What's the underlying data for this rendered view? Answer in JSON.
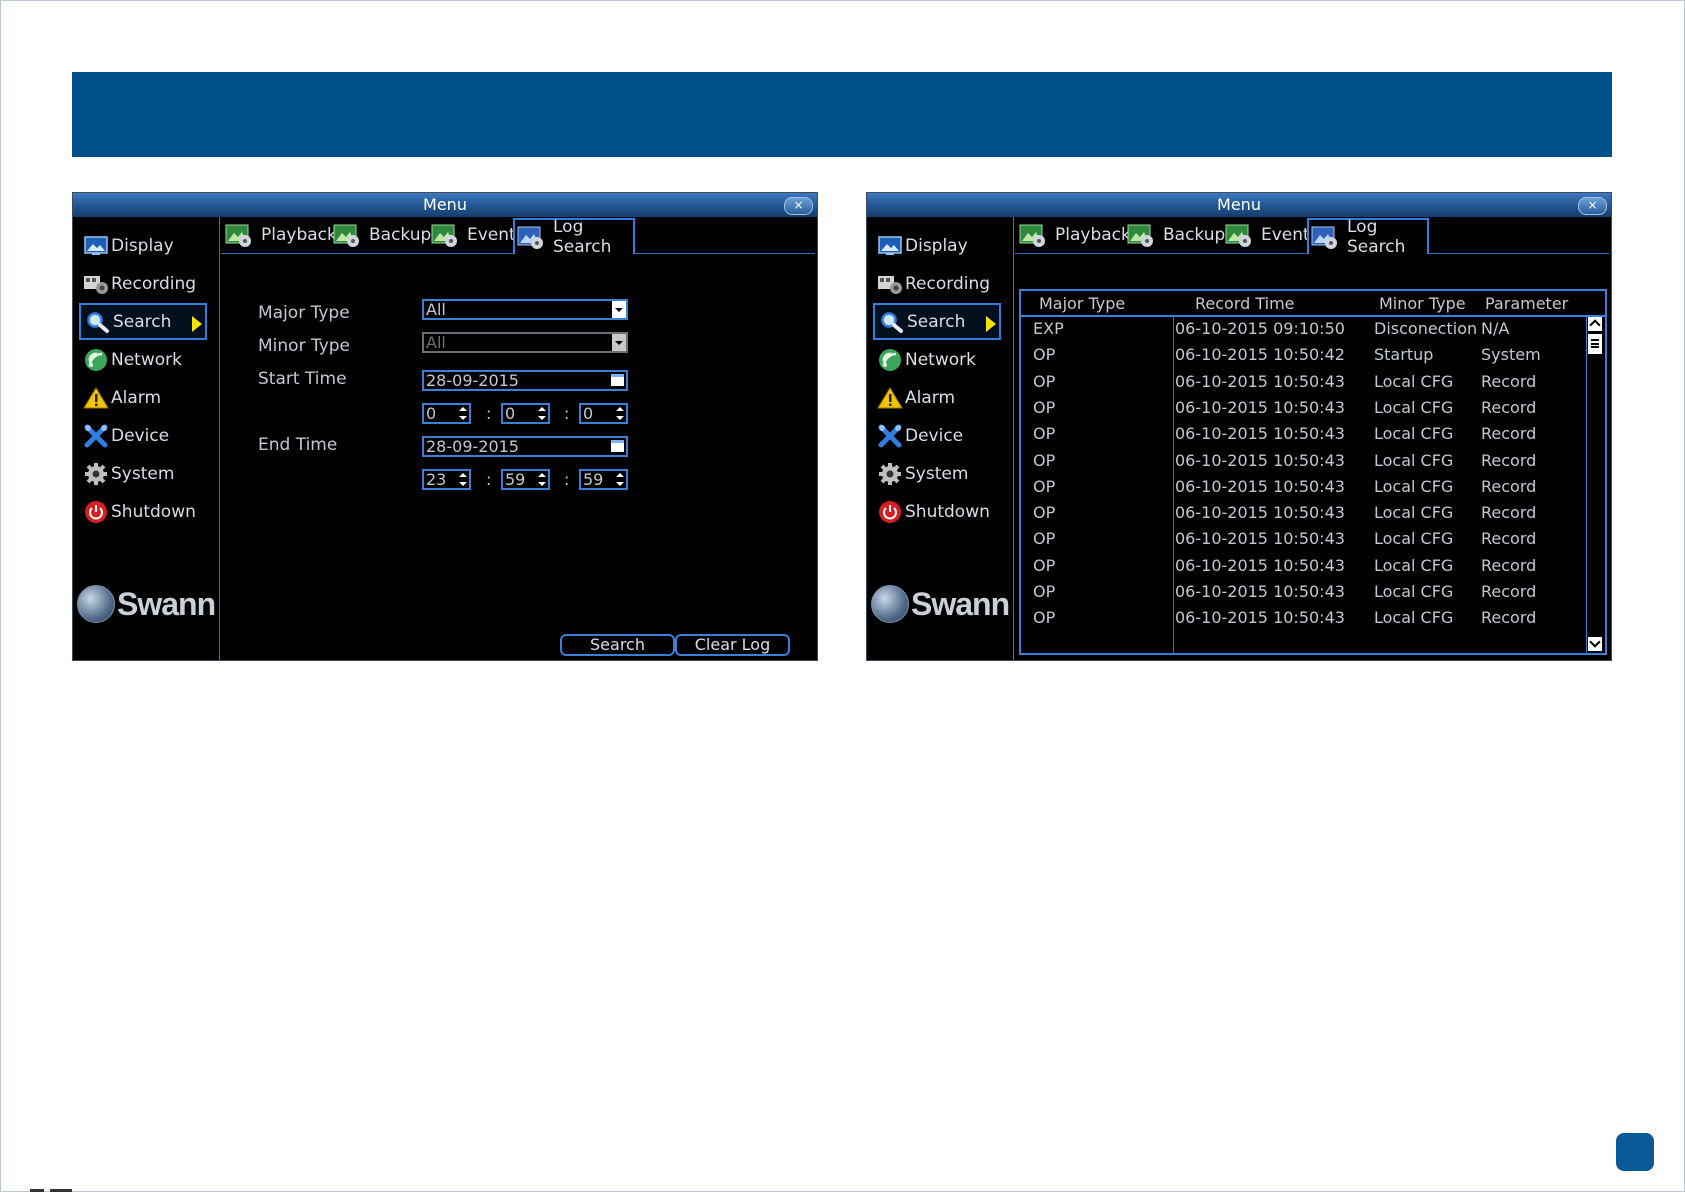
{
  "window_title": "Menu",
  "close_label": "×",
  "sidebar": {
    "items": [
      {
        "label": "Display",
        "icon": "display-icon"
      },
      {
        "label": "Recording",
        "icon": "recording-icon"
      },
      {
        "label": "Search",
        "icon": "search-icon",
        "active": true
      },
      {
        "label": "Network",
        "icon": "network-icon"
      },
      {
        "label": "Alarm",
        "icon": "alarm-icon"
      },
      {
        "label": "Device",
        "icon": "device-icon"
      },
      {
        "label": "System",
        "icon": "system-icon"
      },
      {
        "label": "Shutdown",
        "icon": "shutdown-icon"
      }
    ],
    "logo": "Swann"
  },
  "tabs": [
    {
      "label": "Playback"
    },
    {
      "label": "Backup"
    },
    {
      "label": "Event"
    },
    {
      "label": "Log Search",
      "active": true
    }
  ],
  "log_form": {
    "major_type_label": "Major Type",
    "major_type_value": "All",
    "minor_type_label": "Minor Type",
    "minor_type_value": "All",
    "start_time_label": "Start Time",
    "start_date": "28-09-2015",
    "start_hour": "0",
    "start_minute": "0",
    "start_second": "0",
    "end_time_label": "End Time",
    "end_date": "28-09-2015",
    "end_hour": "23",
    "end_minute": "59",
    "end_second": "59",
    "time_separator": ":",
    "search_button": "Search",
    "clear_log_button": "Clear Log"
  },
  "log_results": {
    "columns": [
      "Major Type",
      "Record Time",
      "Minor Type",
      "Parameter"
    ],
    "rows": [
      [
        "EXP",
        "06-10-2015 09:10:50",
        "Disconection",
        "N/A"
      ],
      [
        "OP",
        "06-10-2015 10:50:42",
        "Startup",
        "System"
      ],
      [
        "OP",
        "06-10-2015 10:50:43",
        "Local CFG",
        "Record"
      ],
      [
        "OP",
        "06-10-2015 10:50:43",
        "Local CFG",
        "Record"
      ],
      [
        "OP",
        "06-10-2015 10:50:43",
        "Local CFG",
        "Record"
      ],
      [
        "OP",
        "06-10-2015 10:50:43",
        "Local CFG",
        "Record"
      ],
      [
        "OP",
        "06-10-2015 10:50:43",
        "Local CFG",
        "Record"
      ],
      [
        "OP",
        "06-10-2015 10:50:43",
        "Local CFG",
        "Record"
      ],
      [
        "OP",
        "06-10-2015 10:50:43",
        "Local CFG",
        "Record"
      ],
      [
        "OP",
        "06-10-2015 10:50:43",
        "Local CFG",
        "Record"
      ],
      [
        "OP",
        "06-10-2015 10:50:43",
        "Local CFG",
        "Record"
      ],
      [
        "OP",
        "06-10-2015 10:50:43",
        "Local CFG",
        "Record"
      ]
    ]
  },
  "colors": {
    "banner": "#02508a",
    "accent_border": "#3a7fd8",
    "active_arrow": "#f5e200",
    "window_bg": "#000000"
  }
}
